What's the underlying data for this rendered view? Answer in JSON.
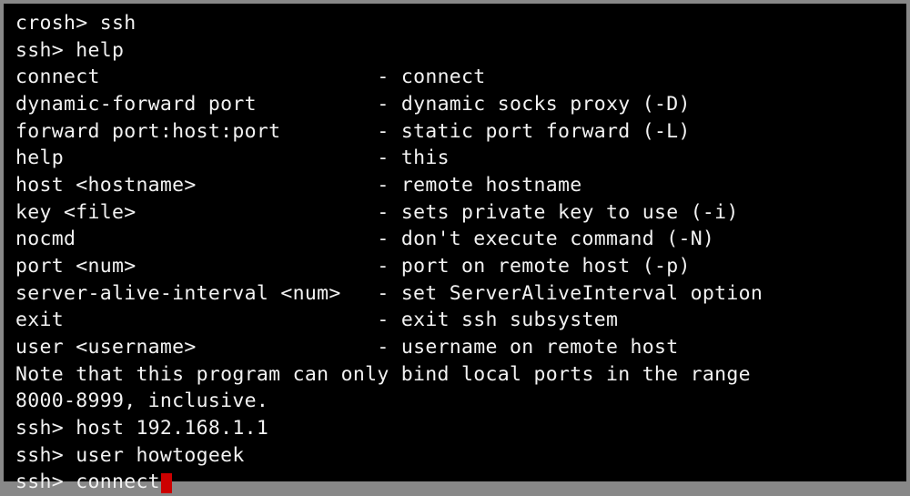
{
  "prompt1": "crosh> ssh",
  "prompt2": "ssh> help",
  "help": [
    {
      "cmd": "connect",
      "desc": "- connect"
    },
    {
      "cmd": "dynamic-forward port",
      "desc": "- dynamic socks proxy (-D)"
    },
    {
      "cmd": "forward port:host:port",
      "desc": "- static port forward (-L)"
    },
    {
      "cmd": "help",
      "desc": "- this"
    },
    {
      "cmd": "host <hostname>",
      "desc": "- remote hostname"
    },
    {
      "cmd": "key <file>",
      "desc": "- sets private key to use (-i)"
    },
    {
      "cmd": "nocmd",
      "desc": "- don't execute command (-N)"
    },
    {
      "cmd": "port <num>",
      "desc": "- port on remote host (-p)"
    },
    {
      "cmd": "server-alive-interval <num>",
      "desc": "- set ServerAliveInterval option"
    },
    {
      "cmd": "exit",
      "desc": "- exit ssh subsystem"
    },
    {
      "cmd": "user <username>",
      "desc": "- username on remote host"
    }
  ],
  "note1": "Note that this program can only bind local ports in the range",
  "note2": "8000-8999, inclusive.",
  "cmd_host": "ssh> host 192.168.1.1",
  "cmd_user": "ssh> user howtogeek",
  "cmd_connect": "ssh> connect"
}
